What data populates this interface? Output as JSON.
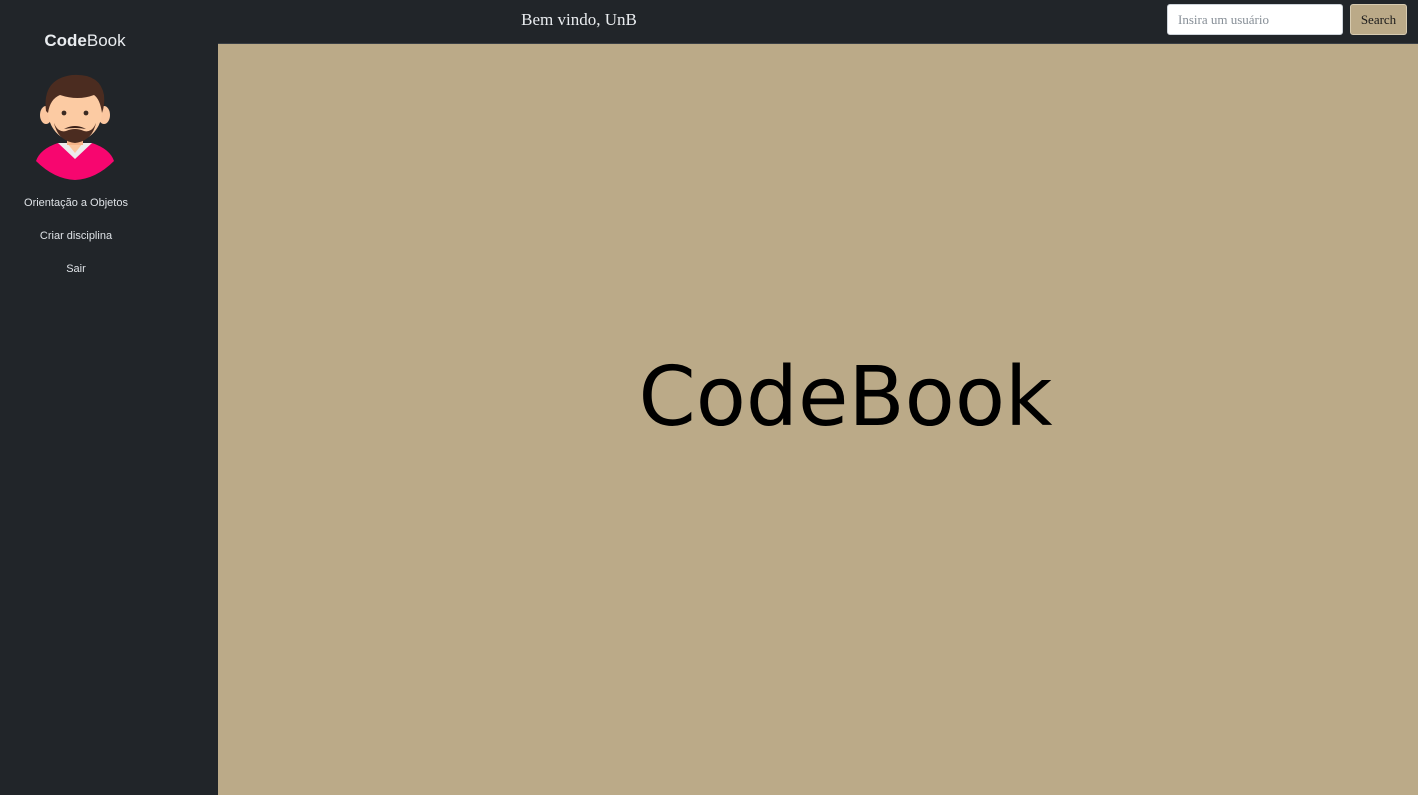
{
  "sidebar": {
    "brand_bold": "Code",
    "brand_regular": "Book",
    "avatar_icon": "user-avatar-icon",
    "items": [
      {
        "label": "Orientação a Objetos"
      },
      {
        "label": "Criar disciplina"
      },
      {
        "label": "Sair"
      }
    ]
  },
  "header": {
    "welcome": "Bem vindo, UnB",
    "search": {
      "placeholder": "Insira um usuário",
      "value": "",
      "button_label": "Search"
    }
  },
  "main": {
    "hero_title": "CodeBook"
  },
  "colors": {
    "sidebar_bg": "#212529",
    "main_bg": "#bbaa88",
    "button_bg": "#bbaa88"
  }
}
